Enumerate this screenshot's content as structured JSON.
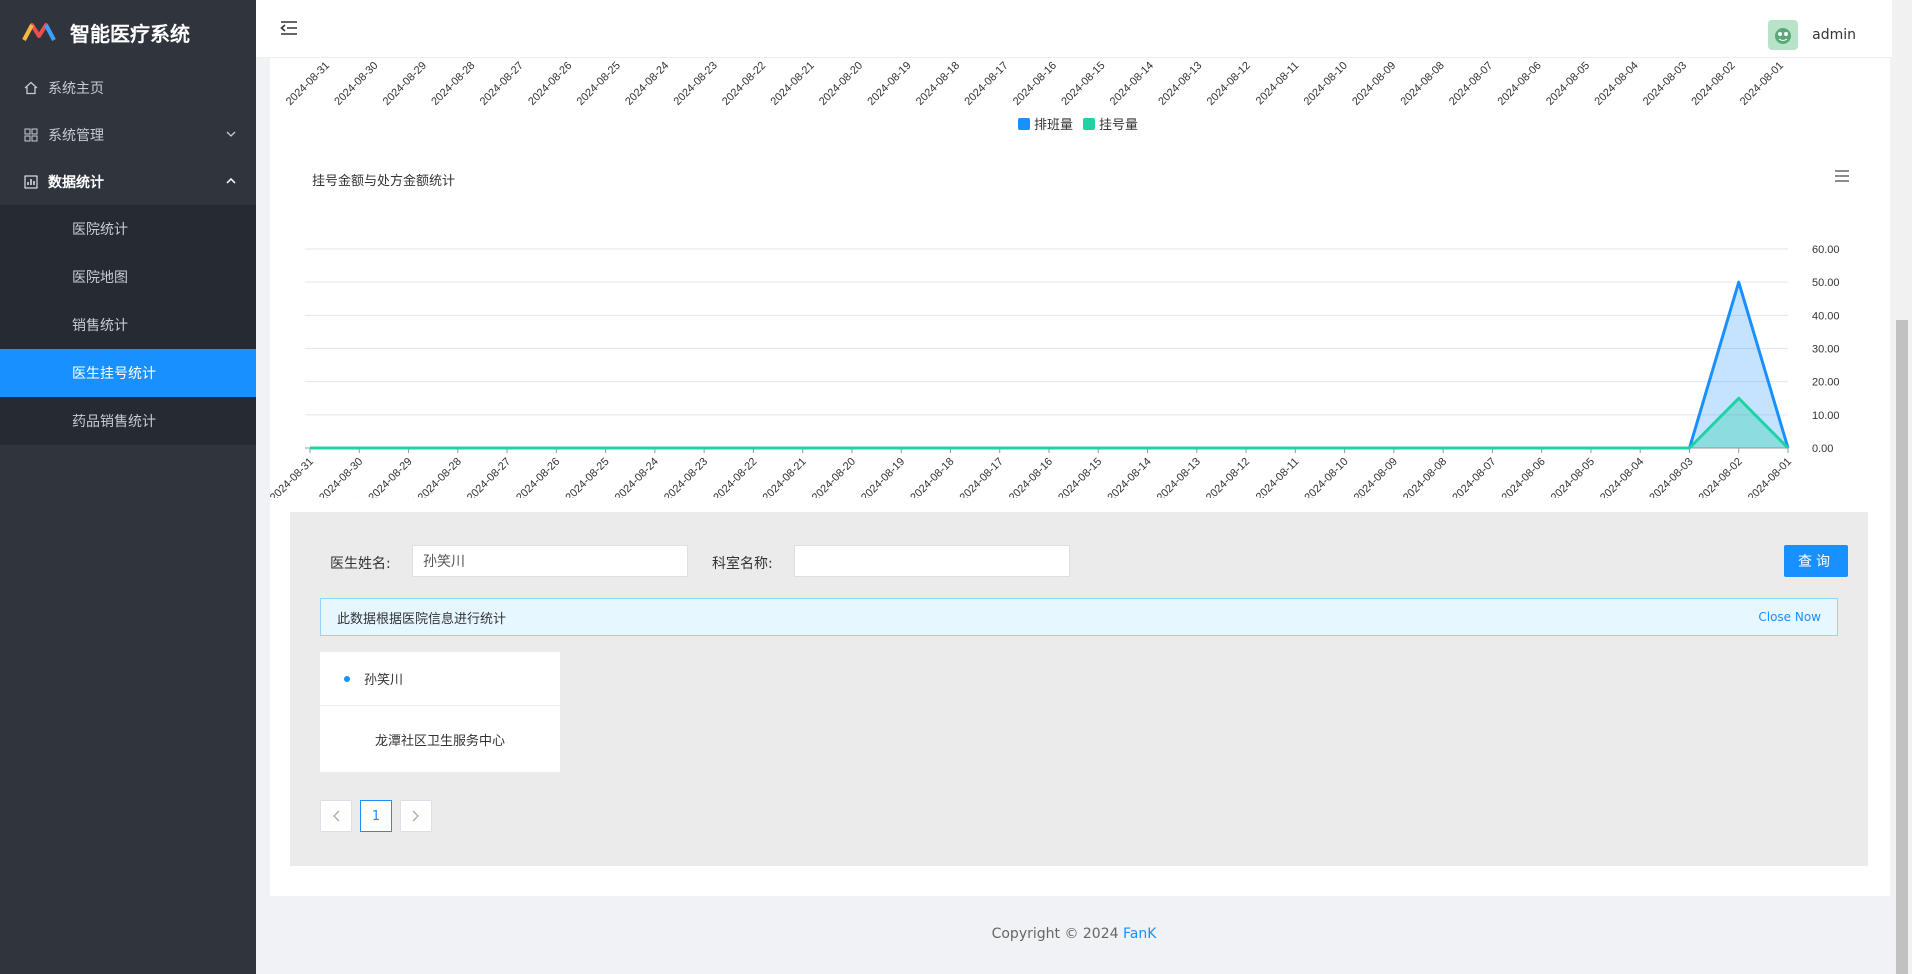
{
  "app": {
    "title": "智能医疗系统"
  },
  "sidebar": {
    "items": [
      {
        "label": "系统主页"
      },
      {
        "label": "系统管理"
      },
      {
        "label": "数据统计"
      }
    ],
    "sub_items": [
      {
        "label": "医院统计"
      },
      {
        "label": "医院地图"
      },
      {
        "label": "销售统计"
      },
      {
        "label": "医生挂号统计"
      },
      {
        "label": "药品销售统计"
      }
    ]
  },
  "header": {
    "username": "admin"
  },
  "chart1": {
    "legend": [
      {
        "name": "排班量",
        "color": "#1890ff"
      },
      {
        "name": "挂号量",
        "color": "#1fd2a3"
      }
    ]
  },
  "chart_data": {
    "type": "area",
    "title": "挂号金额与处方金额统计",
    "categories": [
      "2024-08-31",
      "2024-08-30",
      "2024-08-29",
      "2024-08-28",
      "2024-08-27",
      "2024-08-26",
      "2024-08-25",
      "2024-08-24",
      "2024-08-23",
      "2024-08-22",
      "2024-08-21",
      "2024-08-20",
      "2024-08-19",
      "2024-08-18",
      "2024-08-17",
      "2024-08-16",
      "2024-08-15",
      "2024-08-14",
      "2024-08-13",
      "2024-08-12",
      "2024-08-11",
      "2024-08-10",
      "2024-08-09",
      "2024-08-08",
      "2024-08-07",
      "2024-08-06",
      "2024-08-05",
      "2024-08-04",
      "2024-08-03",
      "2024-08-02",
      "2024-08-01"
    ],
    "series": [
      {
        "name": "挂号金额",
        "color": "#1890ff",
        "values": [
          0,
          0,
          0,
          0,
          0,
          0,
          0,
          0,
          0,
          0,
          0,
          0,
          0,
          0,
          0,
          0,
          0,
          0,
          0,
          0,
          0,
          0,
          0,
          0,
          0,
          0,
          0,
          0,
          0,
          50,
          0
        ]
      },
      {
        "name": "处方金额",
        "color": "#1fd2a3",
        "values": [
          0,
          0,
          0,
          0,
          0,
          0,
          0,
          0,
          0,
          0,
          0,
          0,
          0,
          0,
          0,
          0,
          0,
          0,
          0,
          0,
          0,
          0,
          0,
          0,
          0,
          0,
          0,
          0,
          0,
          15,
          0
        ]
      }
    ],
    "ylim": [
      0,
      60
    ],
    "yticks": [
      "0.00",
      "10.00",
      "20.00",
      "30.00",
      "40.00",
      "50.00",
      "60.00"
    ],
    "y_axis_side": "right",
    "grid": true,
    "legend_position": "bottom-left"
  },
  "query": {
    "doctor_label": "医生姓名:",
    "doctor_value": "孙笑川",
    "dept_label": "科室名称:",
    "dept_value": "",
    "button_label": "查询"
  },
  "alert": {
    "text": "此数据根据医院信息进行统计",
    "close": "Close Now"
  },
  "doctor_card": {
    "name": "孙笑川",
    "hospital": "龙潭社区卫生服务中心"
  },
  "pagination": {
    "prev": "<",
    "page": "1",
    "next": ">"
  },
  "footer": {
    "prefix": "Copyright © 2024 ",
    "author": "FanK"
  }
}
